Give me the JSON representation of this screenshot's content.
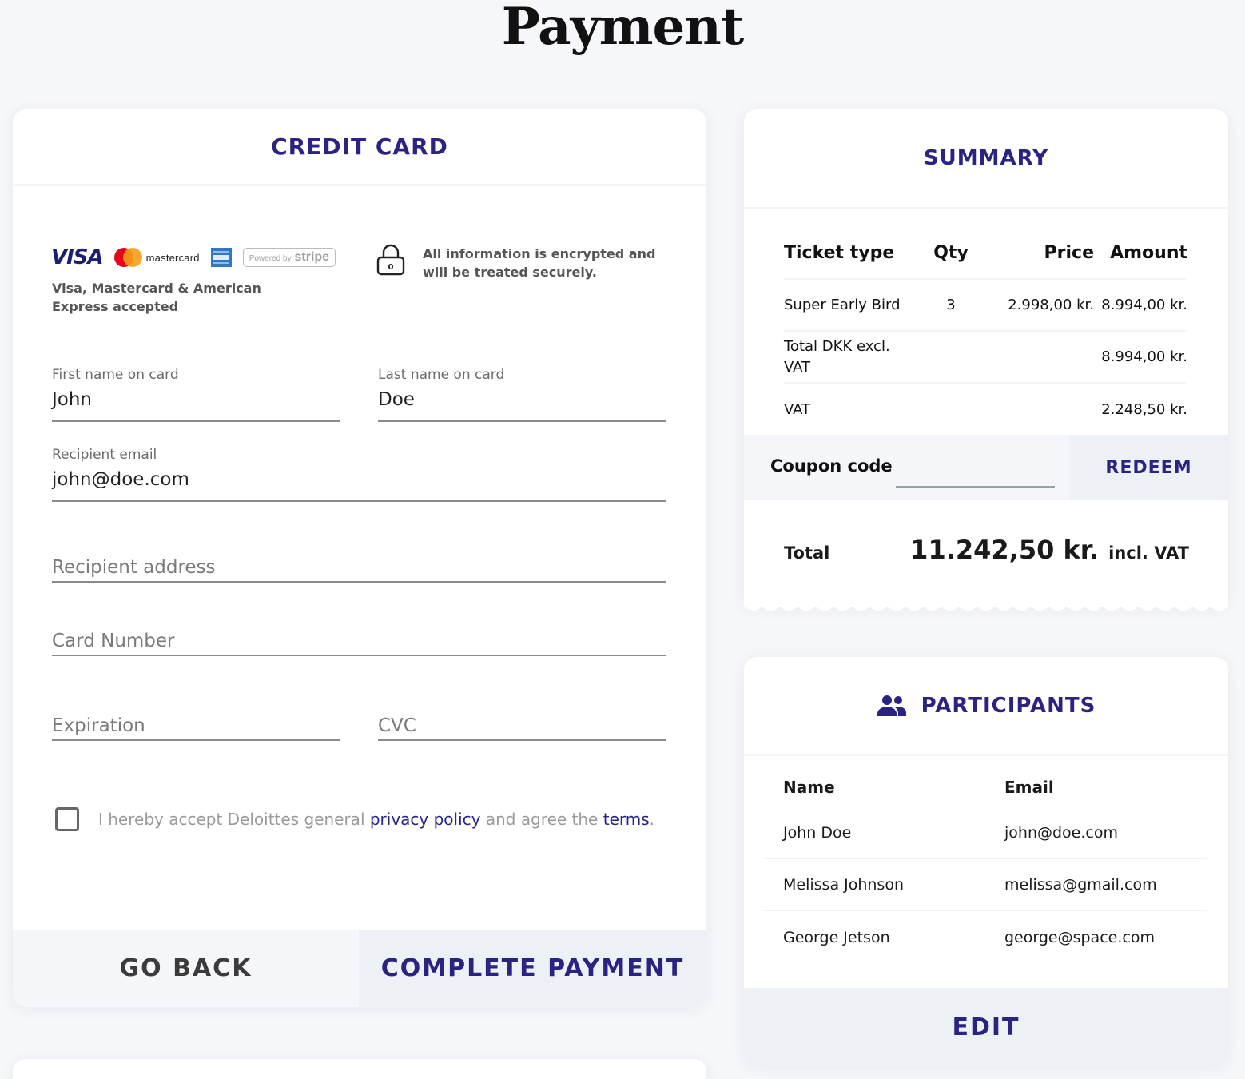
{
  "page": {
    "title": "Payment"
  },
  "colors": {
    "accent": "#2b2382",
    "background": "#f6f7fa",
    "panel": "#ffffff",
    "button_bg": "#edf0f5"
  },
  "credit_card": {
    "heading": "CREDIT CARD",
    "brands": {
      "visa": "VISA",
      "mastercard": "mastercard",
      "stripe_small": "Powered by",
      "stripe_big": "stripe",
      "amex_icon": "amex-logo-icon"
    },
    "accepted_text": "Visa, Mastercard & American Express accepted",
    "secure_text": "All information is encrypted and will be treated securely.",
    "lock_icon_digit": "0",
    "fields": {
      "first_name": {
        "label": "First name on card",
        "value": "John"
      },
      "last_name": {
        "label": "Last name on card",
        "value": "Doe"
      },
      "email": {
        "label": "Recipient email",
        "value": "john@doe.com"
      },
      "address": {
        "placeholder": "Recipient address"
      },
      "card_number": {
        "placeholder": "Card Number"
      },
      "expiration": {
        "placeholder": "Expiration"
      },
      "cvc": {
        "placeholder": "CVC"
      }
    },
    "terms": {
      "prefix": "I hereby accept Deloittes general ",
      "privacy_link": "privacy policy",
      "middle": " and agree the ",
      "terms_link": "terms",
      "suffix": ".",
      "checked": false
    },
    "buttons": {
      "back": "GO BACK",
      "pay": "COMPLETE PAYMENT"
    }
  },
  "summary": {
    "heading": "SUMMARY",
    "columns": [
      "Ticket type",
      "Qty",
      "Price",
      "Amount"
    ],
    "rows": [
      {
        "type": "Super Early Bird",
        "qty": "3",
        "price": "2.998,00 kr.",
        "amount": "8.994,00 kr."
      },
      {
        "type": "Total DKK excl. VAT",
        "qty": "",
        "price": "",
        "amount": "8.994,00 kr."
      },
      {
        "type": "VAT",
        "qty": "",
        "price": "",
        "amount": "2.248,50 kr."
      }
    ],
    "coupon": {
      "label": "Coupon code",
      "value": "",
      "button": "REDEEM"
    },
    "total": {
      "label": "Total",
      "value": "11.242,50 kr.",
      "unit": "incl. VAT"
    }
  },
  "participants": {
    "heading": "PARTICIPANTS",
    "icon": "people-icon",
    "columns": [
      "Name",
      "Email"
    ],
    "rows": [
      {
        "name": "John Doe",
        "email": "john@doe.com"
      },
      {
        "name": "Melissa Johnson",
        "email": "melissa@gmail.com"
      },
      {
        "name": "George Jetson",
        "email": "george@space.com"
      }
    ],
    "edit_button": "EDIT"
  }
}
